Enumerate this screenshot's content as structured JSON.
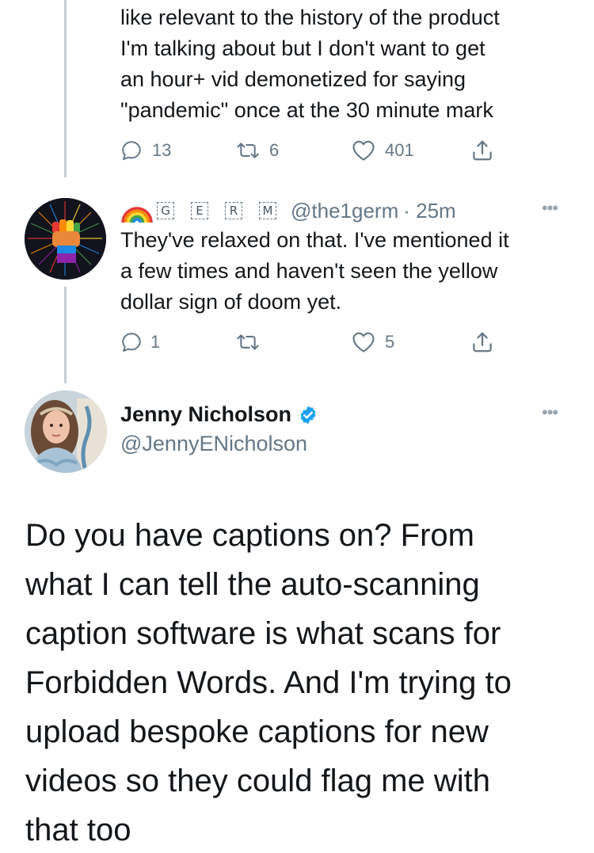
{
  "tweet1": {
    "text_lines": [
      "like relevant to the history of the product",
      "I'm talking about but I don't want to get",
      "an hour+ vid demonetized for saying",
      "\"pandemic\" once at the 30 minute mark"
    ],
    "replies": "13",
    "retweets": "6",
    "likes": "401"
  },
  "tweet2": {
    "name_boxes": [
      "G",
      "E",
      "R",
      "M"
    ],
    "handle": "@the1germ",
    "time": "· 25m",
    "more": "•••",
    "text_lines": [
      "They've relaxed on that. I've mentioned it",
      "a few times and haven't seen the yellow",
      "dollar sign of doom yet."
    ],
    "replies": "1",
    "retweets": "",
    "likes": "5"
  },
  "tweet3": {
    "name": "Jenny Nicholson",
    "handle": "@JennyENicholson",
    "more": "•••",
    "text_lines": [
      "Do you have captions on? From",
      "what I can tell the auto-scanning",
      "caption software is what scans for",
      "Forbidden Words. And I'm trying to",
      "upload bespoke captions for new",
      "videos so they could flag me with",
      "that too"
    ]
  },
  "icons": {
    "reply": "reply-icon",
    "retweet": "retweet-icon",
    "like": "heart-icon",
    "share": "share-icon",
    "verified": "verified-badge-icon"
  },
  "colors": {
    "text": "#14171a",
    "secondary": "#657786",
    "thread_line": "#c4cfd6",
    "verified_blue": "#1da1f2"
  }
}
